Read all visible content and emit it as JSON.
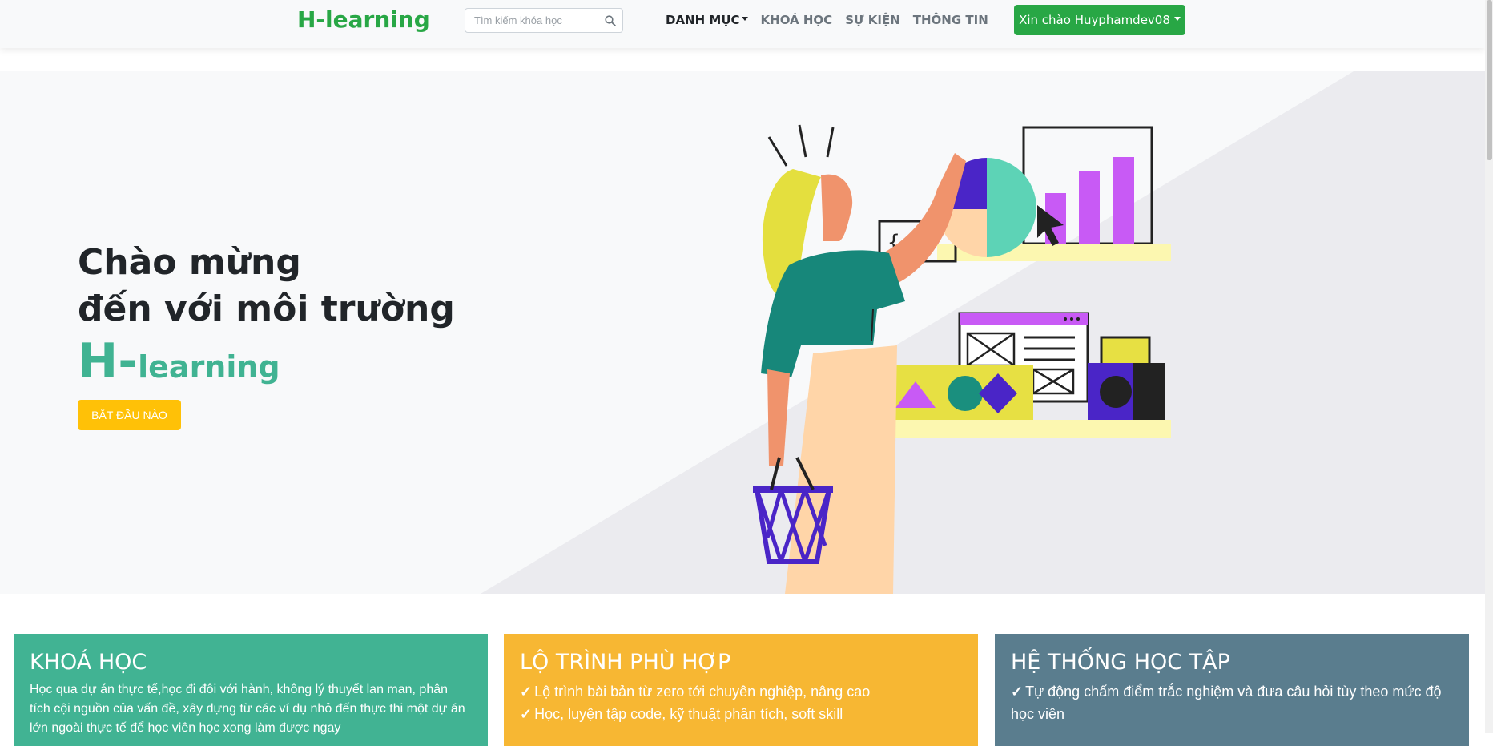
{
  "navbar": {
    "brand": "H-learning",
    "search": {
      "placeholder": "Tìm kiếm khóa học"
    },
    "menu": [
      {
        "label": "DANH MỤC",
        "has_dropdown": true,
        "active": true
      },
      {
        "label": "KHOÁ HỌC"
      },
      {
        "label": "SỰ KIỆN"
      },
      {
        "label": "THÔNG TIN"
      }
    ],
    "user_greeting": "Xin chào Huyphamdev08"
  },
  "hero": {
    "title_line1": "Chào mừng",
    "title_line2": "đến với môi trường",
    "brand_big": "H-",
    "brand_small": "learning",
    "cta_label": "BẮT ĐẦU NÀO"
  },
  "cards": [
    {
      "title": "KHOÁ HỌC",
      "text": "Học qua dự án thực tế,học đi đôi với hành, không lý thuyết lan man, phân tích cội nguồn của vấn đề, xây dựng từ các ví dụ nhỏ đến thực thi một dự án lớn ngoài thực tế để học viên học xong làm được ngay"
    },
    {
      "title": "LỘ TRÌNH PHÙ HỢP",
      "items": [
        "Lộ trình bài bản từ zero tới chuyên nghiệp, nâng cao",
        "Học, luyện tập code, kỹ thuật phân tích, soft skill"
      ]
    },
    {
      "title": "HỆ THỐNG HỌC TẬP",
      "items": [
        "Tự động chấm điểm trắc nghiệm và đưa câu hỏi tùy theo mức độ học viên"
      ]
    }
  ],
  "colors": {
    "brand_green": "#28a745",
    "teal": "#41b393",
    "yellow": "#ffc107",
    "card_yellow": "#f7b733",
    "card_slate": "#5a7d8e",
    "illustration_purple": "#c85af5",
    "illustration_indigo": "#4a25c7"
  }
}
